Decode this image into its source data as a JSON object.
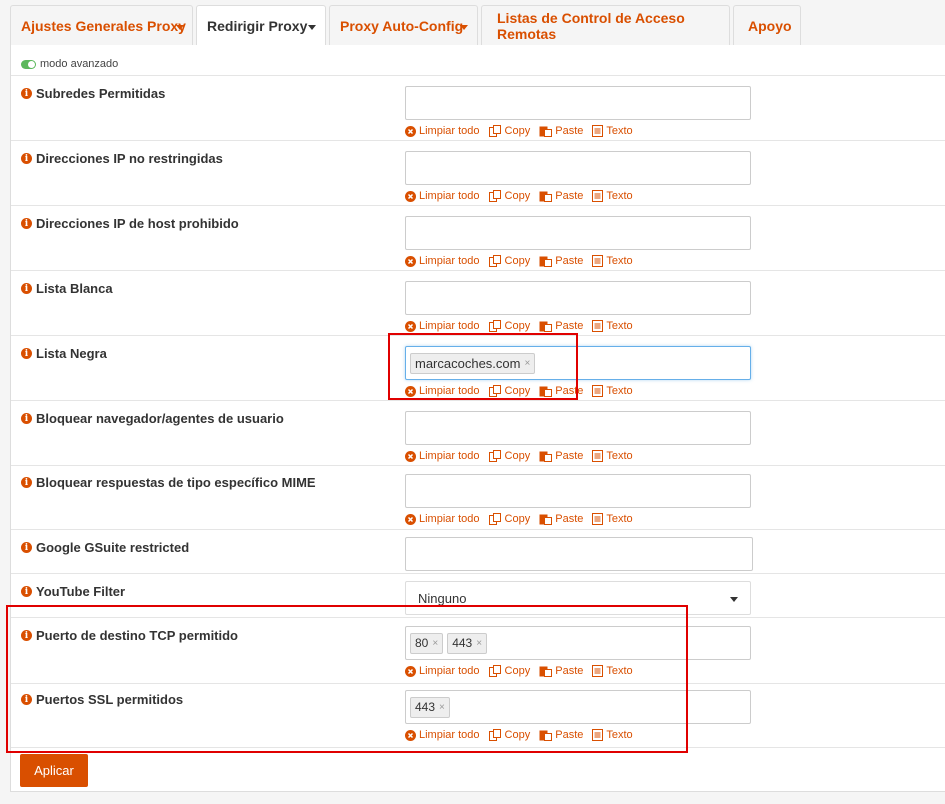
{
  "tabs": [
    {
      "label": "Ajustes Generales Proxy",
      "has_dropdown": true,
      "active": false
    },
    {
      "label": "Redirigir Proxy",
      "has_dropdown": true,
      "active": true
    },
    {
      "label": "Proxy Auto-Config",
      "has_dropdown": true,
      "active": false
    },
    {
      "label": "Listas de Control de Acceso Remotas",
      "has_dropdown": false,
      "active": false
    },
    {
      "label": "Apoyo",
      "has_dropdown": false,
      "active": false
    }
  ],
  "advanced_mode": {
    "label": "modo avanzado",
    "enabled": true
  },
  "field_actions": {
    "clear": "Limpiar todo",
    "copy": "Copy",
    "paste": "Paste",
    "text": "Texto"
  },
  "fields": {
    "subredes": {
      "label": "Subredes Permitidas"
    },
    "ip_no_restringidas": {
      "label": "Direcciones IP no restringidas"
    },
    "ip_prohibido": {
      "label": "Direcciones IP de host prohibido"
    },
    "lista_blanca": {
      "label": "Lista Blanca"
    },
    "lista_negra": {
      "label": "Lista Negra",
      "tags": [
        "marcacoches.com"
      ]
    },
    "agentes": {
      "label": "Bloquear navegador/agentes de usuario"
    },
    "mime": {
      "label": "Bloquear respuestas de tipo específico MIME"
    },
    "gsuite": {
      "label": "Google GSuite restricted"
    },
    "youtube": {
      "label": "YouTube Filter",
      "value": "Ninguno"
    },
    "tcp": {
      "label": "Puerto de destino TCP permitido",
      "tags": [
        "80",
        "443"
      ]
    },
    "ssl": {
      "label": "Puertos SSL permitidos",
      "tags": [
        "443"
      ]
    }
  },
  "apply_label": "Aplicar",
  "colors": {
    "accent": "#d94f00",
    "highlight": "#e00000",
    "toggle": "#5cb85c"
  }
}
